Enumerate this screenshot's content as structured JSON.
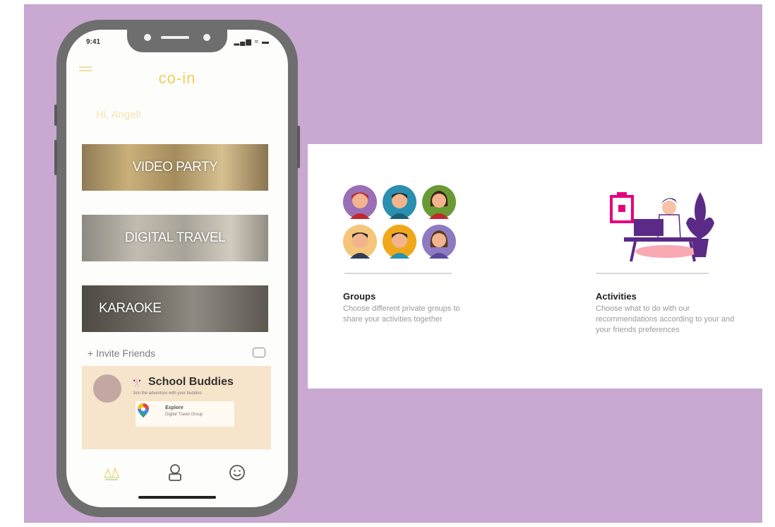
{
  "app": {
    "status_time": "9:41",
    "status_icons": "▂▄▆ ≈ ▬",
    "logo": "co-in",
    "greeting": "Hi, Angel!"
  },
  "banners": [
    {
      "label": "VIDEO PARTY"
    },
    {
      "label": "DIGITAL TRAVEL"
    },
    {
      "label": "KARAOKE"
    }
  ],
  "invite": {
    "label": "+ Invite Friends"
  },
  "group_card": {
    "flag": "🎌",
    "title": "School Buddies",
    "subtitle": "Join the adventure with your buddies",
    "map_title": "Explore",
    "map_subtitle": "Digital Travel Group"
  },
  "tabs": [
    {
      "icon": "party-icon"
    },
    {
      "icon": "profile-icon"
    },
    {
      "icon": "smiley-icon"
    }
  ],
  "features": [
    {
      "title": "Groups",
      "description": "Choose different private groups to share your activities together"
    },
    {
      "title": "Activities",
      "description": "Choose what to do with our recommendations according to your and your friends preferences"
    }
  ],
  "colors": {
    "background": "#c9a8d1",
    "accent": "#f2cf58",
    "card": "#f6e4cb",
    "phone_frame": "#6e6e6e",
    "pink": "#e6007e",
    "purple": "#5b2a86"
  }
}
